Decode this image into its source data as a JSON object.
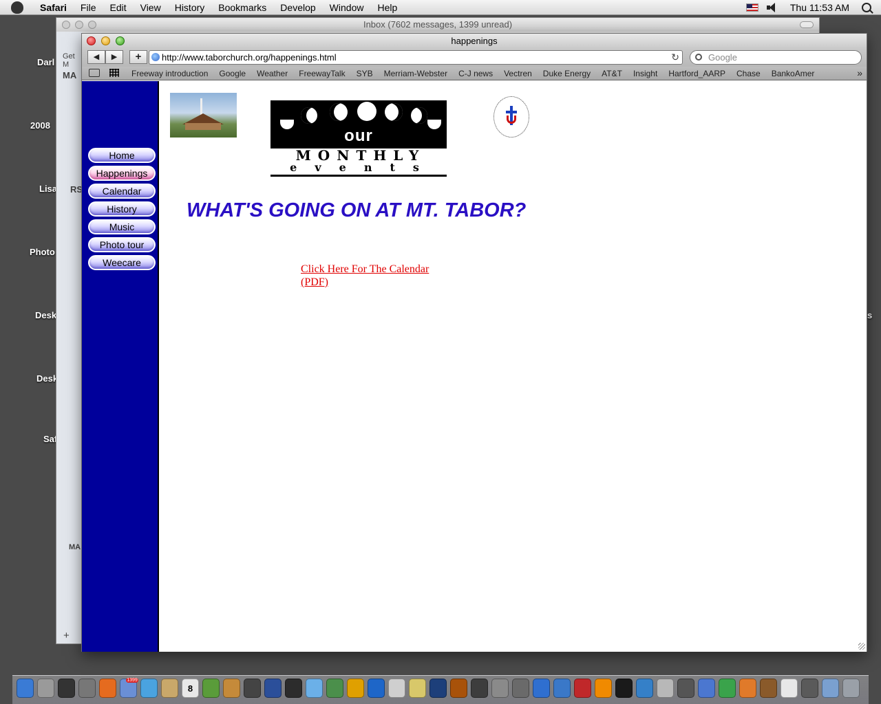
{
  "menubar": {
    "app": "Safari",
    "items": [
      "File",
      "Edit",
      "View",
      "History",
      "Bookmarks",
      "Develop",
      "Window",
      "Help"
    ],
    "clock": "Thu 11:53 AM"
  },
  "desktop_labels": [
    "Darl",
    "2008",
    "Lisa",
    "Photo",
    "Desk",
    "Desk",
    "Saf",
    "s"
  ],
  "mail_window": {
    "title": "Inbox (7602 messages, 1399 unread)",
    "sidebar_text": [
      "Get M",
      "MA",
      "RS",
      "MA"
    ],
    "add_button": "+"
  },
  "safari": {
    "title": "happenings",
    "back": "◀",
    "forward": "▶",
    "add": "+",
    "url": "http://www.taborchurch.org/happenings.html",
    "search_placeholder": "Google",
    "bookmarks": [
      "Freeway introduction",
      "Google",
      "Weather",
      "FreewayTalk",
      "SYB",
      "Merriam-Webster",
      "C-J news",
      "Vectren",
      "Duke Energy",
      "AT&T",
      "Insight",
      "Hartford_AARP",
      "Chase",
      "BankoAmer"
    ],
    "bookmarks_more": "»"
  },
  "page": {
    "nav": [
      "Home",
      "Happenings",
      "Calendar",
      "History",
      "Music",
      "Photo tour",
      "Weecare"
    ],
    "active_nav": "Happenings",
    "logo_our": "our",
    "logo_monthly": "MONTHLY",
    "logo_events": "events",
    "heading": "WHAT'S GOING ON AT MT. TABOR?",
    "calendar_link": "Click Here For The Calendar (PDF)",
    "colors": {
      "sidebar": "#00009b",
      "heading": "#2a0fc4",
      "link": "#e00000"
    }
  },
  "dock": {
    "icon_names": [
      "finder-icon",
      "calculator-icon",
      "dashboard-icon",
      "system-prefs-icon",
      "firefox-icon",
      "mail-icon",
      "safari-icon",
      "address-book-icon",
      "ical-icon",
      "preview-icon",
      "iphoto-icon",
      "imovie-icon",
      "textedit-icon",
      "finalcut-icon",
      "itunes-icon",
      "garageband-icon",
      "audio-icon",
      "dvd-icon",
      "ipod-icon",
      "stickies-icon",
      "photoshop-icon",
      "illustrator-icon",
      "timemachine-icon",
      "utility-icon",
      "automator-icon",
      "quicktime-icon",
      "frontrow-icon",
      "acrobat-icon",
      "vlc-icon",
      "fetch-icon",
      "network-icon",
      "preview2-icon",
      "camera-icon",
      "xcode-icon",
      "grapher-icon",
      "app-icon",
      "pet-icon",
      "spreadsheet-icon",
      "disk-icon",
      "folder-icon",
      "trash-icon"
    ],
    "mail_badge": "1399",
    "ical_day": "8"
  }
}
